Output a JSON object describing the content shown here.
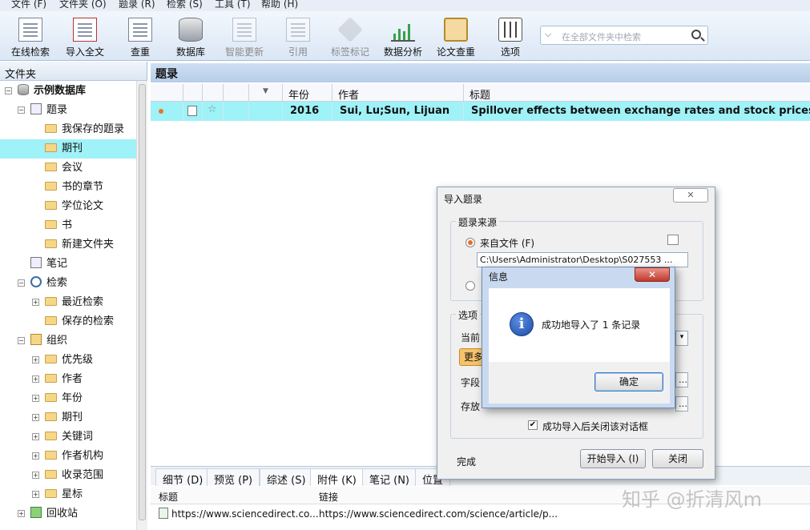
{
  "menu": [
    "文件 (F)",
    "文件夹 (O)",
    "题录 (R)",
    "检索 (S)",
    "工具 (T)",
    "帮助 (H)"
  ],
  "toolbar": {
    "online_search": "在线检索",
    "import_fulltext": "导入全文",
    "dedupe": "查重",
    "database": "数据库",
    "smart_update": "智能更新",
    "cite": "引用",
    "tag": "标签标记",
    "analysis": "数据分析",
    "plagiarism": "论文查重",
    "options": "选项"
  },
  "search": {
    "placeholder": "在全部文件夹中检索",
    "chevron": "⌵"
  },
  "sidebar": {
    "header": "文件夹",
    "tree": [
      {
        "label": "示例数据库",
        "icon": "database-icon"
      },
      {
        "label": "题录",
        "icon": "list-icon"
      },
      {
        "label": "我保存的题录",
        "icon": "folder-icon"
      },
      {
        "label": "期刊",
        "icon": "folder-icon",
        "selected": true
      },
      {
        "label": "会议",
        "icon": "folder-icon"
      },
      {
        "label": "书的章节",
        "icon": "folder-icon"
      },
      {
        "label": "学位论文",
        "icon": "folder-icon"
      },
      {
        "label": "书",
        "icon": "folder-icon"
      },
      {
        "label": "新建文件夹",
        "icon": "folder-icon"
      },
      {
        "label": "笔记",
        "icon": "notebook-icon"
      },
      {
        "label": "检索",
        "icon": "search-icon"
      },
      {
        "label": "最近检索",
        "icon": "folder-icon"
      },
      {
        "label": "保存的检索",
        "icon": "folder-icon"
      },
      {
        "label": "组织",
        "icon": "organize-icon"
      },
      {
        "label": "优先级",
        "icon": "folder-icon"
      },
      {
        "label": "作者",
        "icon": "folder-icon"
      },
      {
        "label": "年份",
        "icon": "folder-icon"
      },
      {
        "label": "期刊",
        "icon": "folder-icon"
      },
      {
        "label": "关键词",
        "icon": "folder-icon"
      },
      {
        "label": "作者机构",
        "icon": "folder-icon"
      },
      {
        "label": "收录范围",
        "icon": "folder-icon"
      },
      {
        "label": "星标",
        "icon": "folder-icon"
      },
      {
        "label": "回收站",
        "icon": "recycle-bin-icon"
      }
    ]
  },
  "main": {
    "title": "题录",
    "columns": {
      "year": "年份",
      "author": "作者",
      "title": "标题"
    },
    "rows": [
      {
        "year": "2016",
        "authors": "Sui, Lu;Sun, Lijuan",
        "title": "Spillover effects between exchange rates and stock prices: Evid"
      }
    ]
  },
  "bottom_tabs": [
    "细节 (D)",
    "预览 (P)",
    "综述 (S)",
    "附件 (K)",
    "笔记 (N)",
    "位置"
  ],
  "attachments": {
    "headers": {
      "title": "标题",
      "link": "链接"
    },
    "rows": [
      {
        "title": "https://www.sciencedirect.co...",
        "link": "https://www.sciencedirect.com/science/article/p..."
      }
    ]
  },
  "import_dialog": {
    "title": "导入题录",
    "source_group": "题录来源",
    "from_file": "来自文件 (F)",
    "file_path": "C:\\Users\\Administrator\\Desktop\\S027553 ...",
    "options_group": "选项",
    "current_label": "当前",
    "more_button": "更多",
    "field_label": "字段",
    "store_label": "存放",
    "close_after_import": "成功导入后关闭该对话框",
    "status": "完成",
    "start_button": "开始导入 (I)",
    "close_button": "关闭"
  },
  "info_dialog": {
    "title": "信息",
    "message": "成功地导入了 1 条记录",
    "ok_button": "确定",
    "icon_glyph": "i",
    "close_glyph": "✕"
  },
  "watermark": "知乎 @折清风m"
}
